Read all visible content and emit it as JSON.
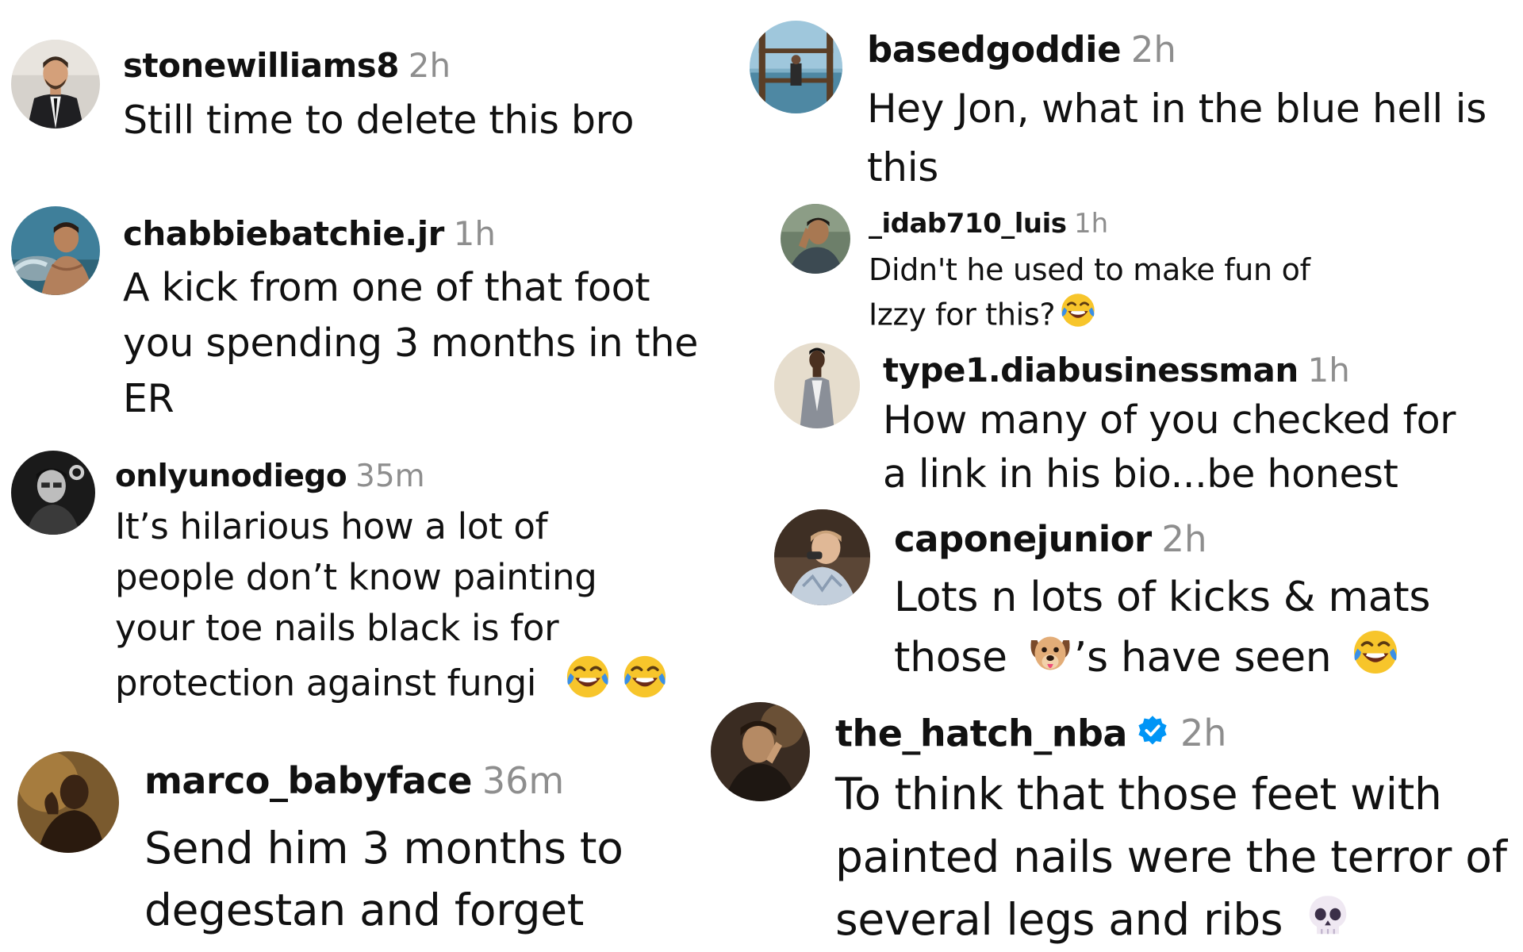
{
  "comments": [
    {
      "username": "stonewilliams8",
      "time": "2h",
      "lines": [
        "Still time to delete this bro"
      ]
    },
    {
      "username": "chabbiebatchie.jr",
      "time": "1h",
      "lines": [
        "A kick from one of that foot",
        "you spending 3 months in the",
        "ER"
      ]
    },
    {
      "username": "onlyunodiego",
      "time": "35m",
      "lines": [
        "It’s hilarious how a lot of",
        "people don’t know painting",
        "your toe nails black is for",
        "protection against fungi"
      ]
    },
    {
      "username": "marco_babyface",
      "time": "36m",
      "lines": [
        "Send him 3 months to",
        "degestan and forget"
      ]
    },
    {
      "username": "basedgoddie",
      "time": "2h",
      "lines": [
        "Hey Jon, what in the blue hell is",
        "this"
      ]
    },
    {
      "username": "_idab710_luis",
      "time": "1h",
      "lines": [
        "Didn't he used to make fun of",
        "Izzy for this?"
      ]
    },
    {
      "username": "type1.diabusinessman",
      "time": "1h",
      "lines": [
        "How many of you checked for",
        "a link in his bio...be honest"
      ]
    },
    {
      "username": "caponejunior",
      "time": "2h",
      "lines": [
        "Lots n lots of kicks & mats",
        "those",
        "’s have seen"
      ]
    },
    {
      "username": "the_hatch_nba",
      "time": "2h",
      "lines": [
        "To think that those feet with",
        "painted nails were the terror of",
        "several legs and ribs"
      ]
    }
  ],
  "icons": {
    "verified": "verified-badge-icon",
    "laugh": "tears-of-joy-emoji",
    "dog": "dog-face-emoji",
    "skull": "skull-emoji"
  },
  "colors": {
    "username": "#111111",
    "timestamp": "#8e8e8e",
    "verified": "#0095f6"
  }
}
